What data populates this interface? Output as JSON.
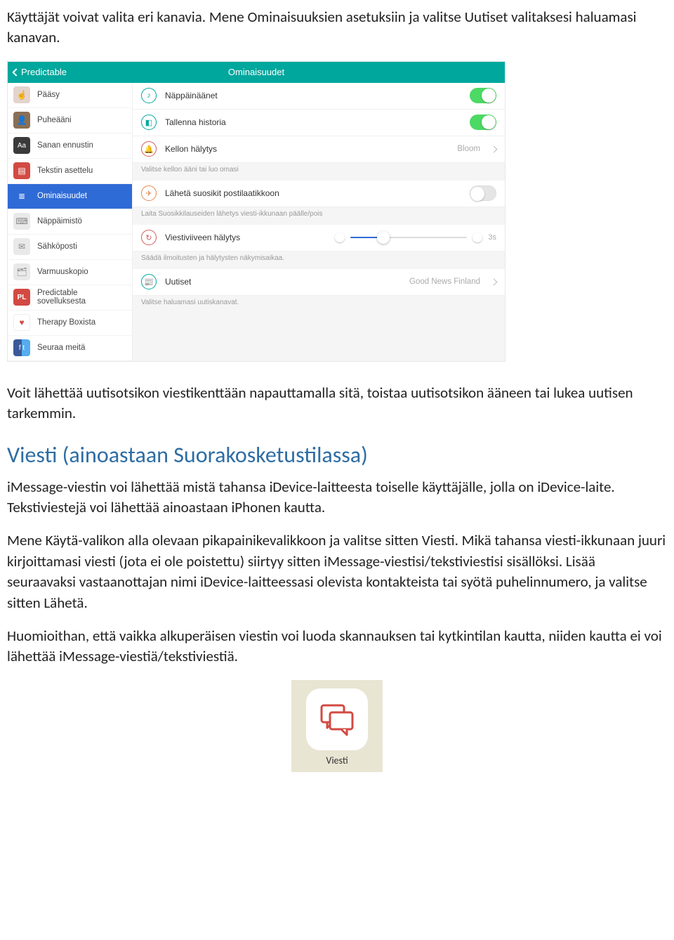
{
  "para1": "Käyttäjät voivat valita eri kanavia. Mene Ominaisuuksien asetuksiin ja valitse Uutiset valitaksesi haluamasi kanavan.",
  "para2": "Voit lähettää uutisotsikon viestikenttään napauttamalla sitä, toistaa uutisotsikon ääneen tai lukea uutisen tarkemmin.",
  "heading1": "Viesti (ainoastaan Suorakosketustilassa)",
  "para3": "iMessage-viestin voi lähettää mistä tahansa iDevice-laitteesta toiselle käyttäjälle, jolla on iDevice-laite. Tekstiviestejä voi lähettää ainoastaan iPhonen kautta.",
  "para4": "Mene Käytä-valikon alla olevaan pikapainikevalikkoon ja valitse sitten Viesti. Mikä tahansa viesti-ikkunaan juuri kirjoittamasi viesti (jota ei ole poistettu) siirtyy sitten iMessage-viestisi/tekstiviestisi sisällöksi. Lisää seuraavaksi vastaanottajan nimi iDevice-laitteessasi olevista kontakteista tai syötä puhelinnumero, ja valitse sitten Lähetä.",
  "para5": "Huomioithan, että vaikka alkuperäisen viestin voi luoda skannauksen tai kytkintilan kautta, niiden kautta ei voi lähettää iMessage-viestiä/tekstiviestiä.",
  "app": {
    "label": "Viesti"
  },
  "shot": {
    "header": {
      "back": "Predictable",
      "title": "Ominaisuudet"
    },
    "sidebar": [
      {
        "label": "Pääsy",
        "bg": "#e3d4cd",
        "glyph": "☝"
      },
      {
        "label": "Puheääni",
        "bg": "#8a6f55",
        "glyph": "👤"
      },
      {
        "label": "Sanan ennustin",
        "bg": "#3a3a3a",
        "glyph": "Aa"
      },
      {
        "label": "Tekstin asettelu",
        "bg": "#d24a43",
        "glyph": "▤"
      },
      {
        "label": "Ominaisuudet",
        "bg": "#2f6bd6",
        "glyph": "≣",
        "active": true
      },
      {
        "label": "Näppäimistö",
        "bg": "#e9e9e9",
        "glyph": "⌨",
        "dark": true
      },
      {
        "label": "Sähköposti",
        "bg": "#e9e9e9",
        "glyph": "✉",
        "dark": true
      },
      {
        "label": "Varmuuskopio",
        "bg": "#e9e9e9",
        "glyph": "🗂",
        "dark": true
      },
      {
        "label": "Predictable sovelluksesta",
        "bg": "#d24a43",
        "glyph": "P"
      },
      {
        "label": "Therapy Boxista",
        "bg": "#fff",
        "glyph": "❤",
        "dark": true
      },
      {
        "label": "Seuraa meitä",
        "bg": "#3b5998",
        "glyph": "f"
      }
    ],
    "rows": {
      "r1": {
        "label": "Näppäinäänet"
      },
      "r2": {
        "label": "Tallenna historia"
      },
      "r3": {
        "label": "Kellon hälytys",
        "value": "Bloom",
        "caption": "Valitse kellon ääni tai luo omasi"
      },
      "r4": {
        "label": "Lähetä suosikit postilaatikkoon",
        "caption": "Laita Suosikkilauseiden lähetys viesti-ikkunaan päälle/pois"
      },
      "r5": {
        "label": "Viestiviiveen hälytys",
        "value": "3s",
        "caption": "Säädä ilmoitusten ja hälytysten näkymisaikaa."
      },
      "r6": {
        "label": "Uutiset",
        "value": "Good News Finland",
        "caption": "Valitse haluamasi uutiskanavat."
      }
    }
  }
}
